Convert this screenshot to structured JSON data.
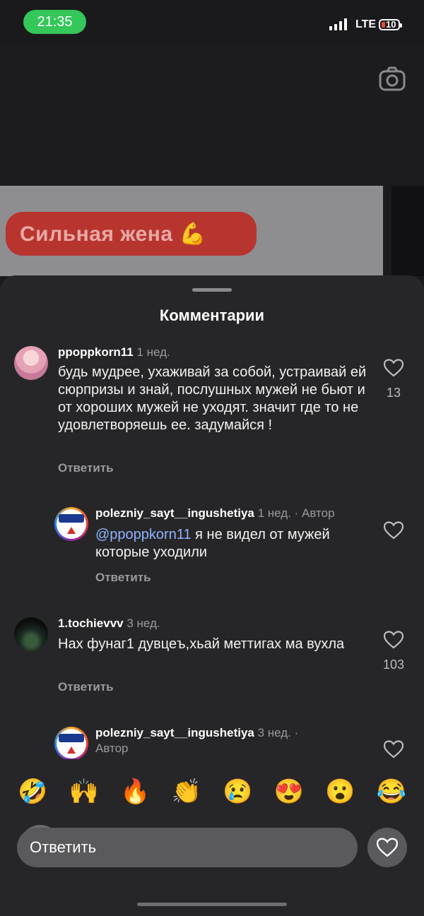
{
  "status_bar": {
    "time": "21:35",
    "network": "LTE",
    "battery": "10"
  },
  "video": {
    "banner_text": "Сильная жена 💪"
  },
  "comments_sheet": {
    "title": "Комментарии",
    "comments": [
      {
        "username": "ppoppkorn11",
        "age": "1 нед.",
        "text": "будь мудрее, ухаживай за собой, устраивай ей сюрпризы и знай, послушных мужей не бьют и от хороших мужей не уходят. значит где то не удовлетворяешь ее. задумайся !",
        "reply_label": "Ответить",
        "likes": "13"
      },
      {
        "username": "polezniy_sayt__ingushetiya",
        "age": "1 нед.",
        "author_tag": "· Автор",
        "mention": "@ppoppkorn11",
        "text": " я не видел от мужей которые уходили",
        "reply_label": "Ответить"
      },
      {
        "username": "1.tochievvv",
        "age": "3 нед.",
        "text": "Нах фунаг1 дувцеъ,хьай меттигах ма вухла",
        "reply_label": "Ответить",
        "likes": "103"
      },
      {
        "username": "polezniy_sayt__ingushetiya",
        "age": "3 нед. ·",
        "author_tag": "Автор"
      }
    ]
  },
  "emoji_reactions": [
    "🤣",
    "🙌",
    "🔥",
    "👏",
    "😢",
    "😍",
    "😮",
    "😂"
  ],
  "reply_bar": {
    "placeholder": "Ответить"
  },
  "icons": {
    "camera": "camera-icon",
    "like": "heart-icon"
  },
  "colors": {
    "status_pill": "#34c759",
    "sheet_bg": "#262628",
    "mention": "#8fb3ff",
    "banner": "#b8352f"
  }
}
